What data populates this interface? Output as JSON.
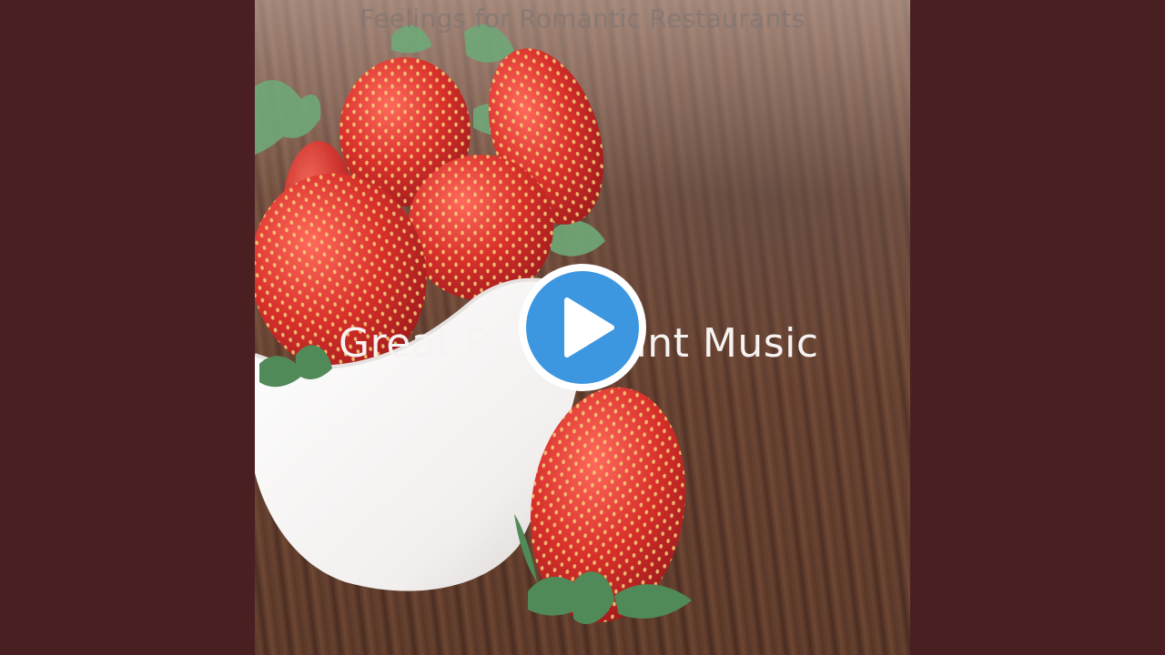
{
  "cover": {
    "title": "Feelings for Romantic Restaurants",
    "subtitle": "Great Restaurant Music"
  },
  "player": {
    "play_button_icon": "play-icon",
    "accent_color": "#3d97e0"
  },
  "colors": {
    "side_background": "#4a1f22",
    "strawberry": "#d7312e"
  }
}
